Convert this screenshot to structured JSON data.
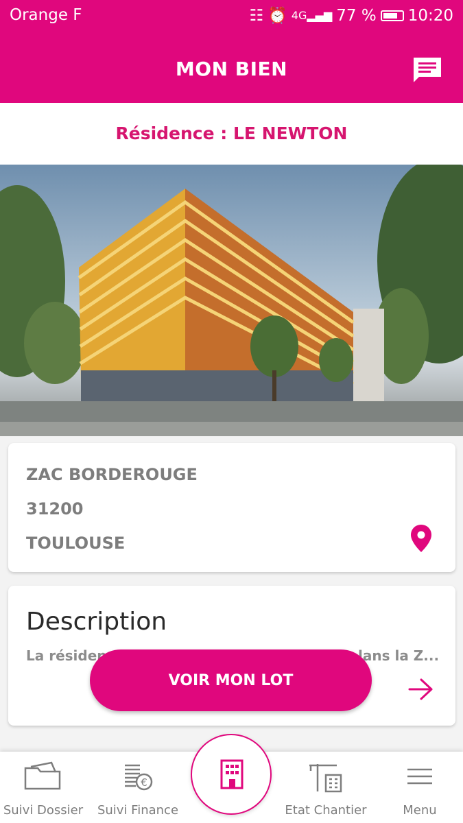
{
  "status_bar": {
    "carrier": "Orange F",
    "battery": "77 %",
    "time": "10:20"
  },
  "header": {
    "title": "MON BIEN",
    "action_icon": "chat-icon"
  },
  "residence": {
    "title": "Résidence : LE NEWTON"
  },
  "address": {
    "street": "ZAC BORDEROUGE",
    "postcode": "31200",
    "city": "TOULOUSE",
    "icon": "location-pin-icon"
  },
  "description": {
    "title": "Description",
    "text_start": "La résiden",
    "text_end": "lans la Z...",
    "icon": "arrow-right-icon"
  },
  "cta": {
    "label": "VOIR MON LOT"
  },
  "bottom_nav": [
    {
      "label": "Suivi Dossier",
      "icon": "folder-icon"
    },
    {
      "label": "Suivi Finance",
      "icon": "finance-icon"
    },
    {
      "label": "",
      "icon": "building-icon"
    },
    {
      "label": "Etat Chantier",
      "icon": "crane-icon"
    },
    {
      "label": "Menu",
      "icon": "hamburger-icon"
    }
  ],
  "colors": {
    "brand": "#e0077d",
    "text_grey": "#7d7d7d"
  }
}
